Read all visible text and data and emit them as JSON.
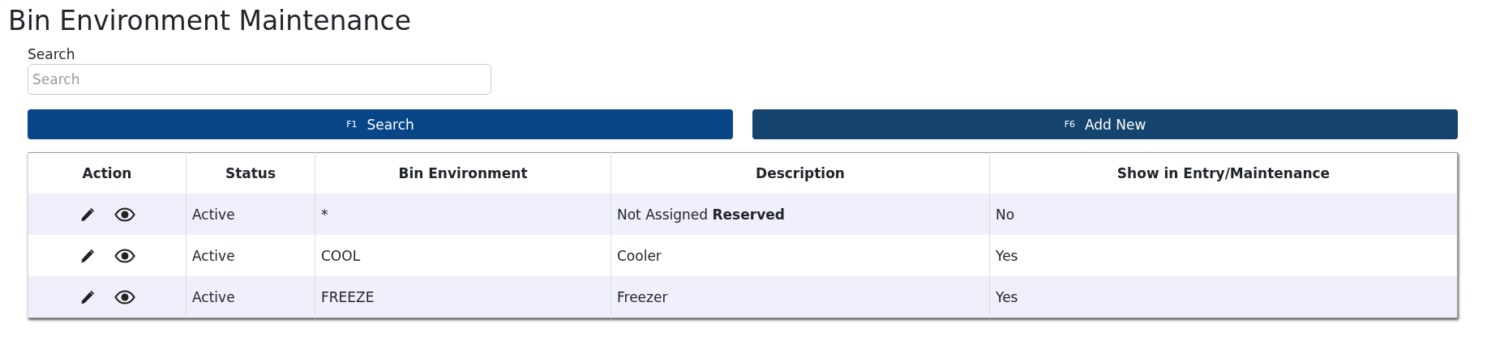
{
  "title": "Bin Environment Maintenance",
  "search": {
    "label": "Search",
    "placeholder": "Search"
  },
  "buttons": [
    {
      "key": "F1",
      "label": "Search",
      "kind": "primary"
    },
    {
      "key": "F6",
      "label": "Add New",
      "kind": "secondary"
    }
  ],
  "table": {
    "columns": [
      "Action",
      "Status",
      "Bin Environment",
      "Description",
      "Show in Entry/Maintenance"
    ],
    "rows": [
      {
        "status": "Active",
        "bin_environment": "*",
        "description": "Not Assigned **Reserved**",
        "show": "No"
      },
      {
        "status": "Active",
        "bin_environment": "COOL",
        "description": "Cooler",
        "show": "Yes"
      },
      {
        "status": "Active",
        "bin_environment": "FREEZE",
        "description": "Freezer",
        "show": "Yes"
      }
    ]
  }
}
